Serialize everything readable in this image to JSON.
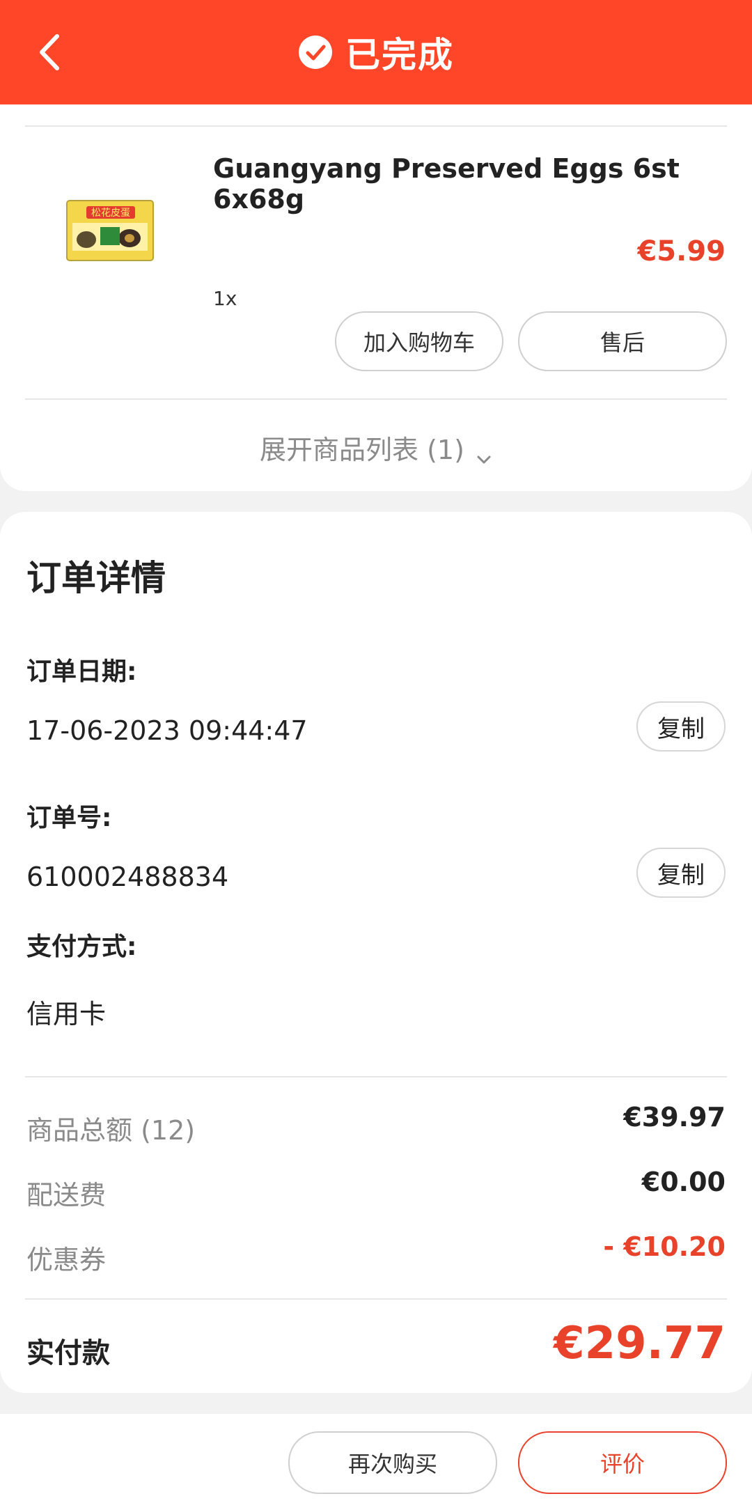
{
  "header": {
    "title": "已完成",
    "back_icon": "back-icon",
    "status_icon": "check-circle-icon",
    "bg_color": "#ff4629"
  },
  "product": {
    "name": "Guangyang Preserved Eggs 6st 6x68g",
    "price": "€5.99",
    "quantity": "1x",
    "image_label": "松花皮蛋",
    "add_to_cart_label": "加入购物车",
    "after_sales_label": "售后",
    "expand_label": "展开商品列表 (1)"
  },
  "details": {
    "title": "订单详情",
    "order_date_label": "订单日期:",
    "order_date_value": "17-06-2023 09:44:47",
    "order_no_label": "订单号:",
    "order_no_value": "610002488834",
    "payment_label": "支付方式:",
    "payment_value": "信用卡",
    "copy_label": "复制"
  },
  "summary": {
    "items_total_label": "商品总额 (12)",
    "items_total_value": "€39.97",
    "shipping_label": "配送费",
    "shipping_value": "€0.00",
    "coupon_label": "优惠券",
    "coupon_value": "- €10.20",
    "paid_label": "实付款",
    "paid_value": "€29.77",
    "accent_color": "#e8422a"
  },
  "actions": {
    "rebuy_label": "再次购买",
    "review_label": "评价"
  }
}
